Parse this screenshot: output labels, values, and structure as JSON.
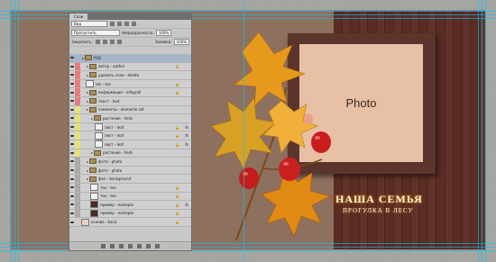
{
  "photo": {
    "label": "Photo"
  },
  "title": {
    "line1": "НАША СЕМЬЯ",
    "line2": "ПРОГУЛКА В ЛЕСУ"
  },
  "panel": {
    "tab": "Слои",
    "kind_label": "Вид",
    "blend": "Пропустить",
    "opacity_label": "Непрозрачность:",
    "opacity_value": "100%",
    "lock_label": "Закрепить:",
    "fill_label": "Заливка:",
    "fill_value": "100%"
  },
  "layers": [
    {
      "name": "PSD",
      "type": "group",
      "tag": "",
      "depth": 0,
      "sel": true
    },
    {
      "name": "автор - author",
      "type": "group",
      "tag": "#e87c7c",
      "depth": 1,
      "lock": true
    },
    {
      "name": "удалить слои - delete",
      "type": "group",
      "tag": "#e87c7c",
      "depth": 1
    },
    {
      "name": "ton - ton",
      "type": "layer",
      "tag": "#e87c7c",
      "depth": 1,
      "lock": true
    },
    {
      "name": "информация - infografi",
      "type": "group",
      "tag": "#e87c7c",
      "depth": 1,
      "lock": true
    },
    {
      "name": "текст - text",
      "type": "group",
      "tag": "#e87c7c",
      "depth": 1
    },
    {
      "name": "элементы - elements set",
      "type": "group",
      "tag": "#e6e27a",
      "depth": 1
    },
    {
      "name": "растение - herb",
      "type": "group",
      "tag": "#e6e27a",
      "depth": 2
    },
    {
      "name": "лист - leaf",
      "type": "layer",
      "tag": "#e6e27a",
      "depth": 3,
      "lock": true,
      "fx": true
    },
    {
      "name": "лист - leaf",
      "type": "layer",
      "tag": "#e6e27a",
      "depth": 3,
      "lock": true,
      "fx": true
    },
    {
      "name": "лист - leaf",
      "type": "layer",
      "tag": "#e6e27a",
      "depth": 3,
      "lock": true,
      "fx": true
    },
    {
      "name": "растение - herb",
      "type": "group",
      "tag": "#e6e27a",
      "depth": 2
    },
    {
      "name": "фото - photo",
      "type": "group",
      "tag": "#a9a9a9",
      "depth": 1
    },
    {
      "name": "фото - photo",
      "type": "group",
      "tag": "#a9a9a9",
      "depth": 1
    },
    {
      "name": "фон - background",
      "type": "group",
      "tag": "#a9a9a9",
      "depth": 1
    },
    {
      "name": "тон - ton",
      "type": "layer",
      "tag": "#a9a9a9",
      "depth": 2,
      "lock": true
    },
    {
      "name": "тон - ton",
      "type": "layer",
      "tag": "#a9a9a9",
      "depth": 2,
      "lock": true
    },
    {
      "name": "пример - example",
      "type": "layer",
      "tag": "#a9a9a9",
      "depth": 2,
      "thumb": "dark",
      "lock": true,
      "fx": true
    },
    {
      "name": "пример - example",
      "type": "layer",
      "tag": "#a9a9a9",
      "depth": 2,
      "thumb": "dark",
      "lock": true
    },
    {
      "name": "основа - basic",
      "type": "layer",
      "tag": "",
      "depth": 0,
      "thumb": "pink",
      "lock": true
    }
  ]
}
